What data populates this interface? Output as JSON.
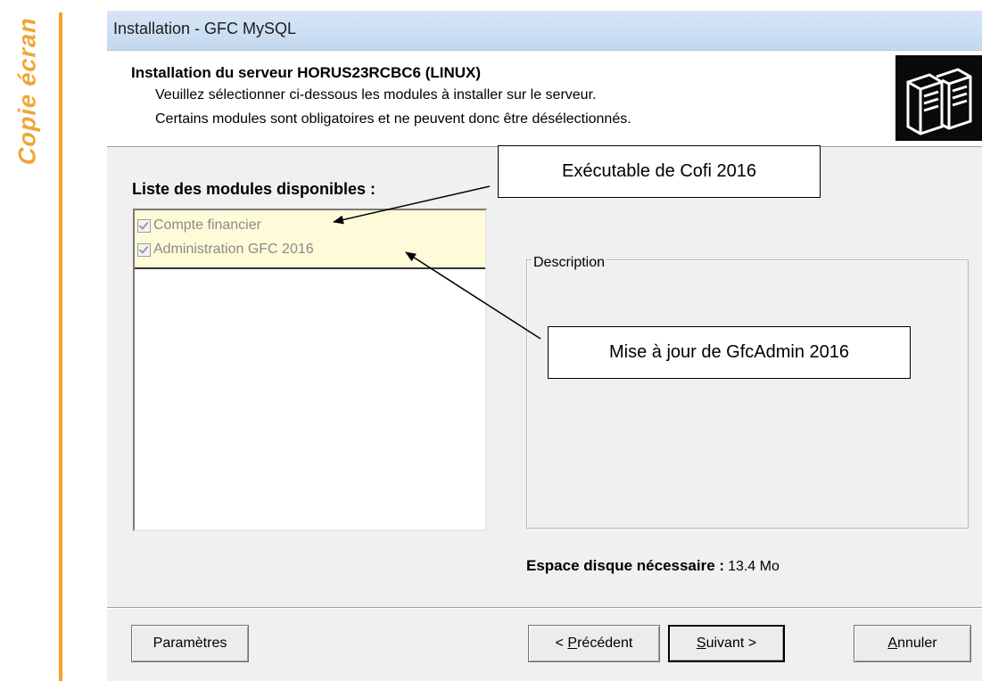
{
  "side_label": "Copie écran",
  "window": {
    "title": "Installation - GFC MySQL"
  },
  "header": {
    "title": "Installation du serveur HORUS23RCBC6 (LINUX)",
    "line1": "Veuillez sélectionner ci-dessous les modules à installer sur le serveur.",
    "line2": "Certains modules sont obligatoires et ne peuvent donc être désélectionnés.",
    "icon": "servers-icon"
  },
  "modules": {
    "label": "Liste des modules disponibles :",
    "items": [
      {
        "label": "Compte financier",
        "checked": true,
        "disabled": true
      },
      {
        "label": "Administration GFC 2016",
        "checked": true,
        "disabled": true
      }
    ]
  },
  "description": {
    "legend": "Description"
  },
  "disk": {
    "label": "Espace disque nécessaire :",
    "value": "13.4 Mo"
  },
  "buttons": {
    "params": "Paramètres",
    "prev_prefix": "< ",
    "prev_accel": "P",
    "prev_rest": "récédent",
    "next_accel": "S",
    "next_rest": "uivant >",
    "cancel_accel": "A",
    "cancel_rest": "nnuler"
  },
  "annotations": {
    "callout1": "Exécutable de Cofi 2016",
    "callout2": "Mise à jour de GfcAdmin 2016"
  },
  "colors": {
    "accent_orange": "#f2a22b",
    "list_highlight": "#fffbd9",
    "titlebar": "#c3d8ef"
  }
}
